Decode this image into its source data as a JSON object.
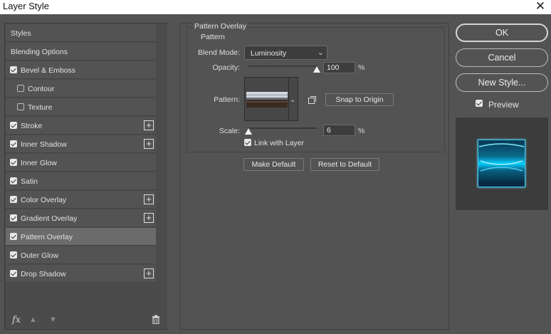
{
  "window": {
    "title": "Layer Style",
    "close_icon": "close-icon"
  },
  "styles_list": {
    "items": [
      {
        "label": "Styles",
        "checkbox": "none",
        "plus": false,
        "selected": false
      },
      {
        "label": "Blending Options",
        "checkbox": "none",
        "plus": false,
        "selected": false
      },
      {
        "label": "Bevel & Emboss",
        "checkbox": "checked",
        "plus": false,
        "selected": false
      },
      {
        "label": "Contour",
        "checkbox": "unchecked",
        "plus": false,
        "selected": false
      },
      {
        "label": "Texture",
        "checkbox": "unchecked",
        "plus": false,
        "selected": false
      },
      {
        "label": "Stroke",
        "checkbox": "checked",
        "plus": true,
        "selected": false
      },
      {
        "label": "Inner Shadow",
        "checkbox": "checked",
        "plus": true,
        "selected": false
      },
      {
        "label": "Inner Glow",
        "checkbox": "checked",
        "plus": false,
        "selected": false
      },
      {
        "label": "Satin",
        "checkbox": "checked",
        "plus": false,
        "selected": false
      },
      {
        "label": "Color Overlay",
        "checkbox": "checked",
        "plus": true,
        "selected": false
      },
      {
        "label": "Gradient Overlay",
        "checkbox": "checked",
        "plus": true,
        "selected": false
      },
      {
        "label": "Pattern Overlay",
        "checkbox": "checked",
        "plus": false,
        "selected": true
      },
      {
        "label": "Outer Glow",
        "checkbox": "checked",
        "plus": false,
        "selected": false
      },
      {
        "label": "Drop Shadow",
        "checkbox": "checked",
        "plus": true,
        "selected": false
      }
    ],
    "footer": {
      "fx_label": "fx",
      "fx_icon": "fx-icon",
      "up_icon": "arrow-up-icon",
      "down_icon": "arrow-down-icon",
      "delete_icon": "trash-icon"
    }
  },
  "pattern_overlay": {
    "group_title": "Pattern Overlay",
    "subgroup_title": "Pattern",
    "blend_mode": {
      "label": "Blend Mode:",
      "value": "Luminosity"
    },
    "opacity": {
      "label": "Opacity:",
      "value": "100",
      "unit": "%",
      "level": 1.0
    },
    "pattern": {
      "label": "Pattern:",
      "snap_button": "Snap to Origin",
      "new_preset_icon": "new-preset-icon"
    },
    "scale": {
      "label": "Scale:",
      "value": "6",
      "unit": "%",
      "level": 0.0
    },
    "link_with_layer": {
      "label": "Link with Layer",
      "checked": true
    },
    "make_default_button": "Make Default",
    "reset_default_button": "Reset to Default"
  },
  "actions": {
    "ok": "OK",
    "cancel": "Cancel",
    "new_style": "New Style...",
    "preview_label": "Preview",
    "preview_checked": true
  },
  "colors": {
    "dialog_bg": "#535353",
    "panel_bg": "#4b4b4b",
    "selected_bg": "#6b6b6b",
    "preview_glow": "#00d4ff"
  }
}
